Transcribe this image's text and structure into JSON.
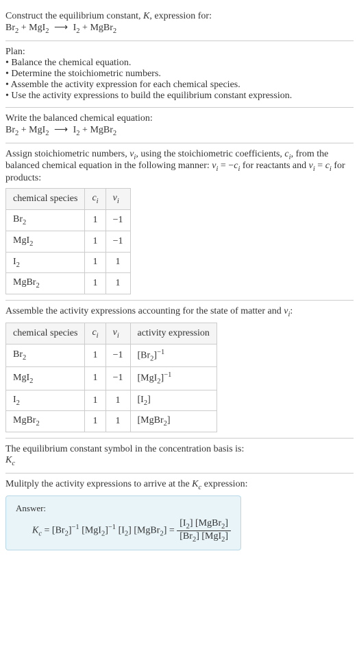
{
  "intro": {
    "line1": "Construct the equilibrium constant, ",
    "K": "K",
    "line1b": ", expression for:",
    "equation_lhs1": "Br",
    "equation_lhs1_sub": "2",
    "plus1": " + ",
    "equation_lhs2": "MgI",
    "equation_lhs2_sub": "2",
    "arrow": "⟶",
    "equation_rhs1": "I",
    "equation_rhs1_sub": "2",
    "plus2": " + ",
    "equation_rhs2": "MgBr",
    "equation_rhs2_sub": "2"
  },
  "plan": {
    "header": "Plan:",
    "b1": "• Balance the chemical equation.",
    "b2": "• Determine the stoichiometric numbers.",
    "b3": "• Assemble the activity expression for each chemical species.",
    "b4": "• Use the activity expressions to build the equilibrium constant expression."
  },
  "balanced": {
    "header": "Write the balanced chemical equation:"
  },
  "stoich": {
    "text1": "Assign stoichiometric numbers, ",
    "nu": "ν",
    "i": "i",
    "text2": ", using the stoichiometric coefficients, ",
    "c": "c",
    "text3": ", from the balanced chemical equation in the following manner: ",
    "rel1a": "ν",
    "rel1b": " = −",
    "rel1c": "c",
    "text4": " for reactants and ",
    "rel2a": "ν",
    "rel2b": " = ",
    "rel2c": "c",
    "text5": " for products:",
    "headers": {
      "h1": "chemical species",
      "h2": "c",
      "h2sub": "i",
      "h3": "ν",
      "h3sub": "i"
    },
    "rows": [
      {
        "species": "Br",
        "sub": "2",
        "ci": "1",
        "nui": "−1"
      },
      {
        "species": "MgI",
        "sub": "2",
        "ci": "1",
        "nui": "−1"
      },
      {
        "species": "I",
        "sub": "2",
        "ci": "1",
        "nui": "1"
      },
      {
        "species": "MgBr",
        "sub": "2",
        "ci": "1",
        "nui": "1"
      }
    ]
  },
  "activity": {
    "header": "Assemble the activity expressions accounting for the state of matter and ",
    "nu": "ν",
    "i": "i",
    "colon": ":",
    "headers": {
      "h1": "chemical species",
      "h2": "c",
      "h2sub": "i",
      "h3": "ν",
      "h3sub": "i",
      "h4": "activity expression"
    },
    "rows": [
      {
        "species": "Br",
        "sub": "2",
        "ci": "1",
        "nui": "−1",
        "expr_base": "[Br",
        "expr_sub": "2",
        "expr_close": "]",
        "expr_sup": "−1"
      },
      {
        "species": "MgI",
        "sub": "2",
        "ci": "1",
        "nui": "−1",
        "expr_base": "[MgI",
        "expr_sub": "2",
        "expr_close": "]",
        "expr_sup": "−1"
      },
      {
        "species": "I",
        "sub": "2",
        "ci": "1",
        "nui": "1",
        "expr_base": "[I",
        "expr_sub": "2",
        "expr_close": "]",
        "expr_sup": ""
      },
      {
        "species": "MgBr",
        "sub": "2",
        "ci": "1",
        "nui": "1",
        "expr_base": "[MgBr",
        "expr_sub": "2",
        "expr_close": "]",
        "expr_sup": ""
      }
    ]
  },
  "symbol": {
    "text": "The equilibrium constant symbol in the concentration basis is:",
    "K": "K",
    "c": "c"
  },
  "multiply": {
    "text1": "Mulitply the activity expressions to arrive at the ",
    "K": "K",
    "c": "c",
    "text2": " expression:"
  },
  "answer": {
    "label": "Answer:",
    "Kc_K": "K",
    "Kc_c": "c",
    "eq": " = ",
    "t1": "[Br",
    "t1sub": "2",
    "t1close": "]",
    "t1sup": "−1",
    "sp": " ",
    "t2": "[MgI",
    "t2sub": "2",
    "t2close": "]",
    "t2sup": "−1",
    "t3": "[I",
    "t3sub": "2",
    "t3close": "]",
    "t4": "[MgBr",
    "t4sub": "2",
    "t4close": "]",
    "eq2": " = ",
    "num1": "[I",
    "num1sub": "2",
    "num1close": "] ",
    "num2": "[MgBr",
    "num2sub": "2",
    "num2close": "]",
    "den1": "[Br",
    "den1sub": "2",
    "den1close": "] ",
    "den2": "[MgI",
    "den2sub": "2",
    "den2close": "]"
  }
}
